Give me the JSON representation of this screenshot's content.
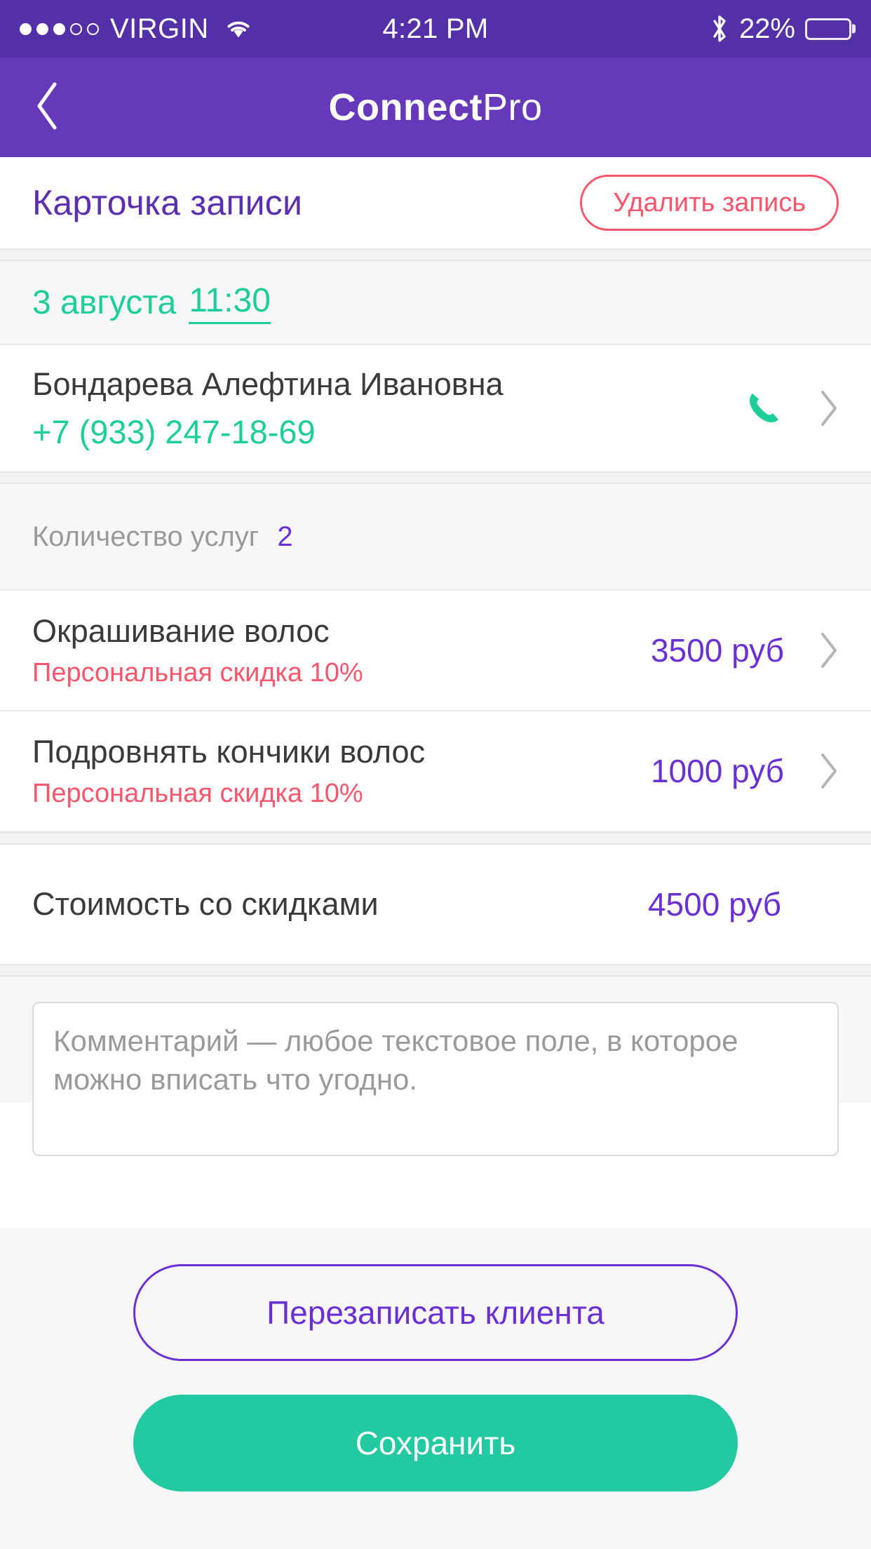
{
  "status_bar": {
    "carrier": "VIRGIN",
    "signal_filled": 3,
    "signal_total": 5,
    "wifi_icon": "wifi-icon",
    "time": "4:21 PM",
    "bluetooth_icon": "bluetooth-icon",
    "battery_percent": "22%",
    "battery_level": 22,
    "background": "#5330A8"
  },
  "nav_bar": {
    "back_icon": "chevron-left-icon",
    "title_bold": "Connect",
    "title_light": "Pro",
    "background": "#6639BA"
  },
  "page_header": {
    "title": "Карточка записи",
    "title_color": "#5B2FB0",
    "delete_button": "Удалить запись",
    "delete_color": "#F9556B"
  },
  "appointment": {
    "date": "3 августа",
    "time": "11:30",
    "accent_color": "#1ECE9A"
  },
  "client": {
    "name": "Бондарева Алефтина Ивановна",
    "phone": "+7 (933) 247-18-69",
    "phone_icon": "phone-icon",
    "chevron_icon": "chevron-right-icon"
  },
  "services_header": {
    "label": "Количество услуг",
    "count": "2",
    "count_color": "#6B2FD6"
  },
  "services": [
    {
      "name": "Окрашивание волос",
      "discount": "Персональная скидка 10%",
      "price": "3500 руб",
      "chevron_icon": "chevron-right-icon"
    },
    {
      "name": "Подровнять кончики волос",
      "discount": "Персональная скидка 10%",
      "price": "1000 руб",
      "chevron_icon": "chevron-right-icon"
    }
  ],
  "total": {
    "label": "Стоимость со скидками",
    "value": "4500 руб",
    "value_color": "#6B2FD6"
  },
  "comment": {
    "value": "",
    "placeholder": "Комментарий — любое текстовое поле, в которое можно вписать что угодно."
  },
  "actions": {
    "reschedule_label": "Перезаписать клиента",
    "reschedule_color": "#6B2FD6",
    "save_label": "Сохранить",
    "save_background": "#23C9A0"
  }
}
